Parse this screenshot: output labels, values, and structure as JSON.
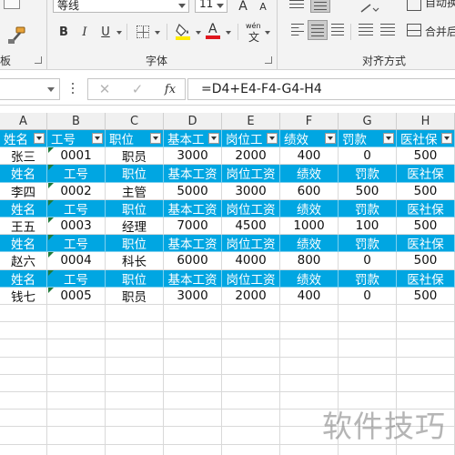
{
  "ribbon": {
    "font_name": "等线",
    "font_size": "11",
    "grow_label": "A",
    "shrink_label": "A",
    "bold_label": "B",
    "italic_label": "I",
    "underline_label": "U",
    "font_color_label": "A",
    "pinyin_label": "wén",
    "group_clipboard": "板",
    "group_font": "字体",
    "group_align": "对齐方式",
    "autowrap_label": "自动换",
    "merge_label": "合并后",
    "colors": {
      "accent": "#1f9ed3",
      "font_color": "#e0161e",
      "fill_yellow": "#ffeb00"
    }
  },
  "formula_bar": {
    "cell_ref": "",
    "fx_label": "fx",
    "formula": "=D4+E4-F4-G4-H4"
  },
  "sheet": {
    "columns": [
      "A",
      "B",
      "C",
      "D",
      "E",
      "F",
      "G",
      "H"
    ],
    "header_fill": "#00a6e2",
    "rows": [
      {
        "type": "header",
        "filters": true,
        "cells": [
          "姓名",
          "工号",
          "职位",
          "基本工",
          "岗位工",
          "绩效",
          "罚款",
          "医社保"
        ]
      },
      {
        "type": "data",
        "cells": [
          "张三",
          "0001",
          "职员",
          "3000",
          "2000",
          "400",
          "0",
          "500"
        ]
      },
      {
        "type": "header",
        "cells": [
          "姓名",
          "工号",
          "职位",
          "基本工资",
          "岗位工资",
          "绩效",
          "罚款",
          "医社保"
        ]
      },
      {
        "type": "data",
        "cells": [
          "李四",
          "0002",
          "主管",
          "5000",
          "3000",
          "600",
          "500",
          "500"
        ]
      },
      {
        "type": "header",
        "cells": [
          "姓名",
          "工号",
          "职位",
          "基本工资",
          "岗位工资",
          "绩效",
          "罚款",
          "医社保"
        ]
      },
      {
        "type": "data",
        "cells": [
          "王五",
          "0003",
          "经理",
          "7000",
          "4500",
          "1000",
          "100",
          "500"
        ]
      },
      {
        "type": "header",
        "cells": [
          "姓名",
          "工号",
          "职位",
          "基本工资",
          "岗位工资",
          "绩效",
          "罚款",
          "医社保"
        ]
      },
      {
        "type": "data",
        "cells": [
          "赵六",
          "0004",
          "科长",
          "6000",
          "4000",
          "800",
          "0",
          "500"
        ]
      },
      {
        "type": "header",
        "cells": [
          "姓名",
          "工号",
          "职位",
          "基本工资",
          "岗位工资",
          "绩效",
          "罚款",
          "医社保"
        ]
      },
      {
        "type": "data",
        "cells": [
          "钱七",
          "0005",
          "职员",
          "3000",
          "2000",
          "400",
          "0",
          "500"
        ]
      }
    ]
  },
  "watermark": "软件技巧"
}
